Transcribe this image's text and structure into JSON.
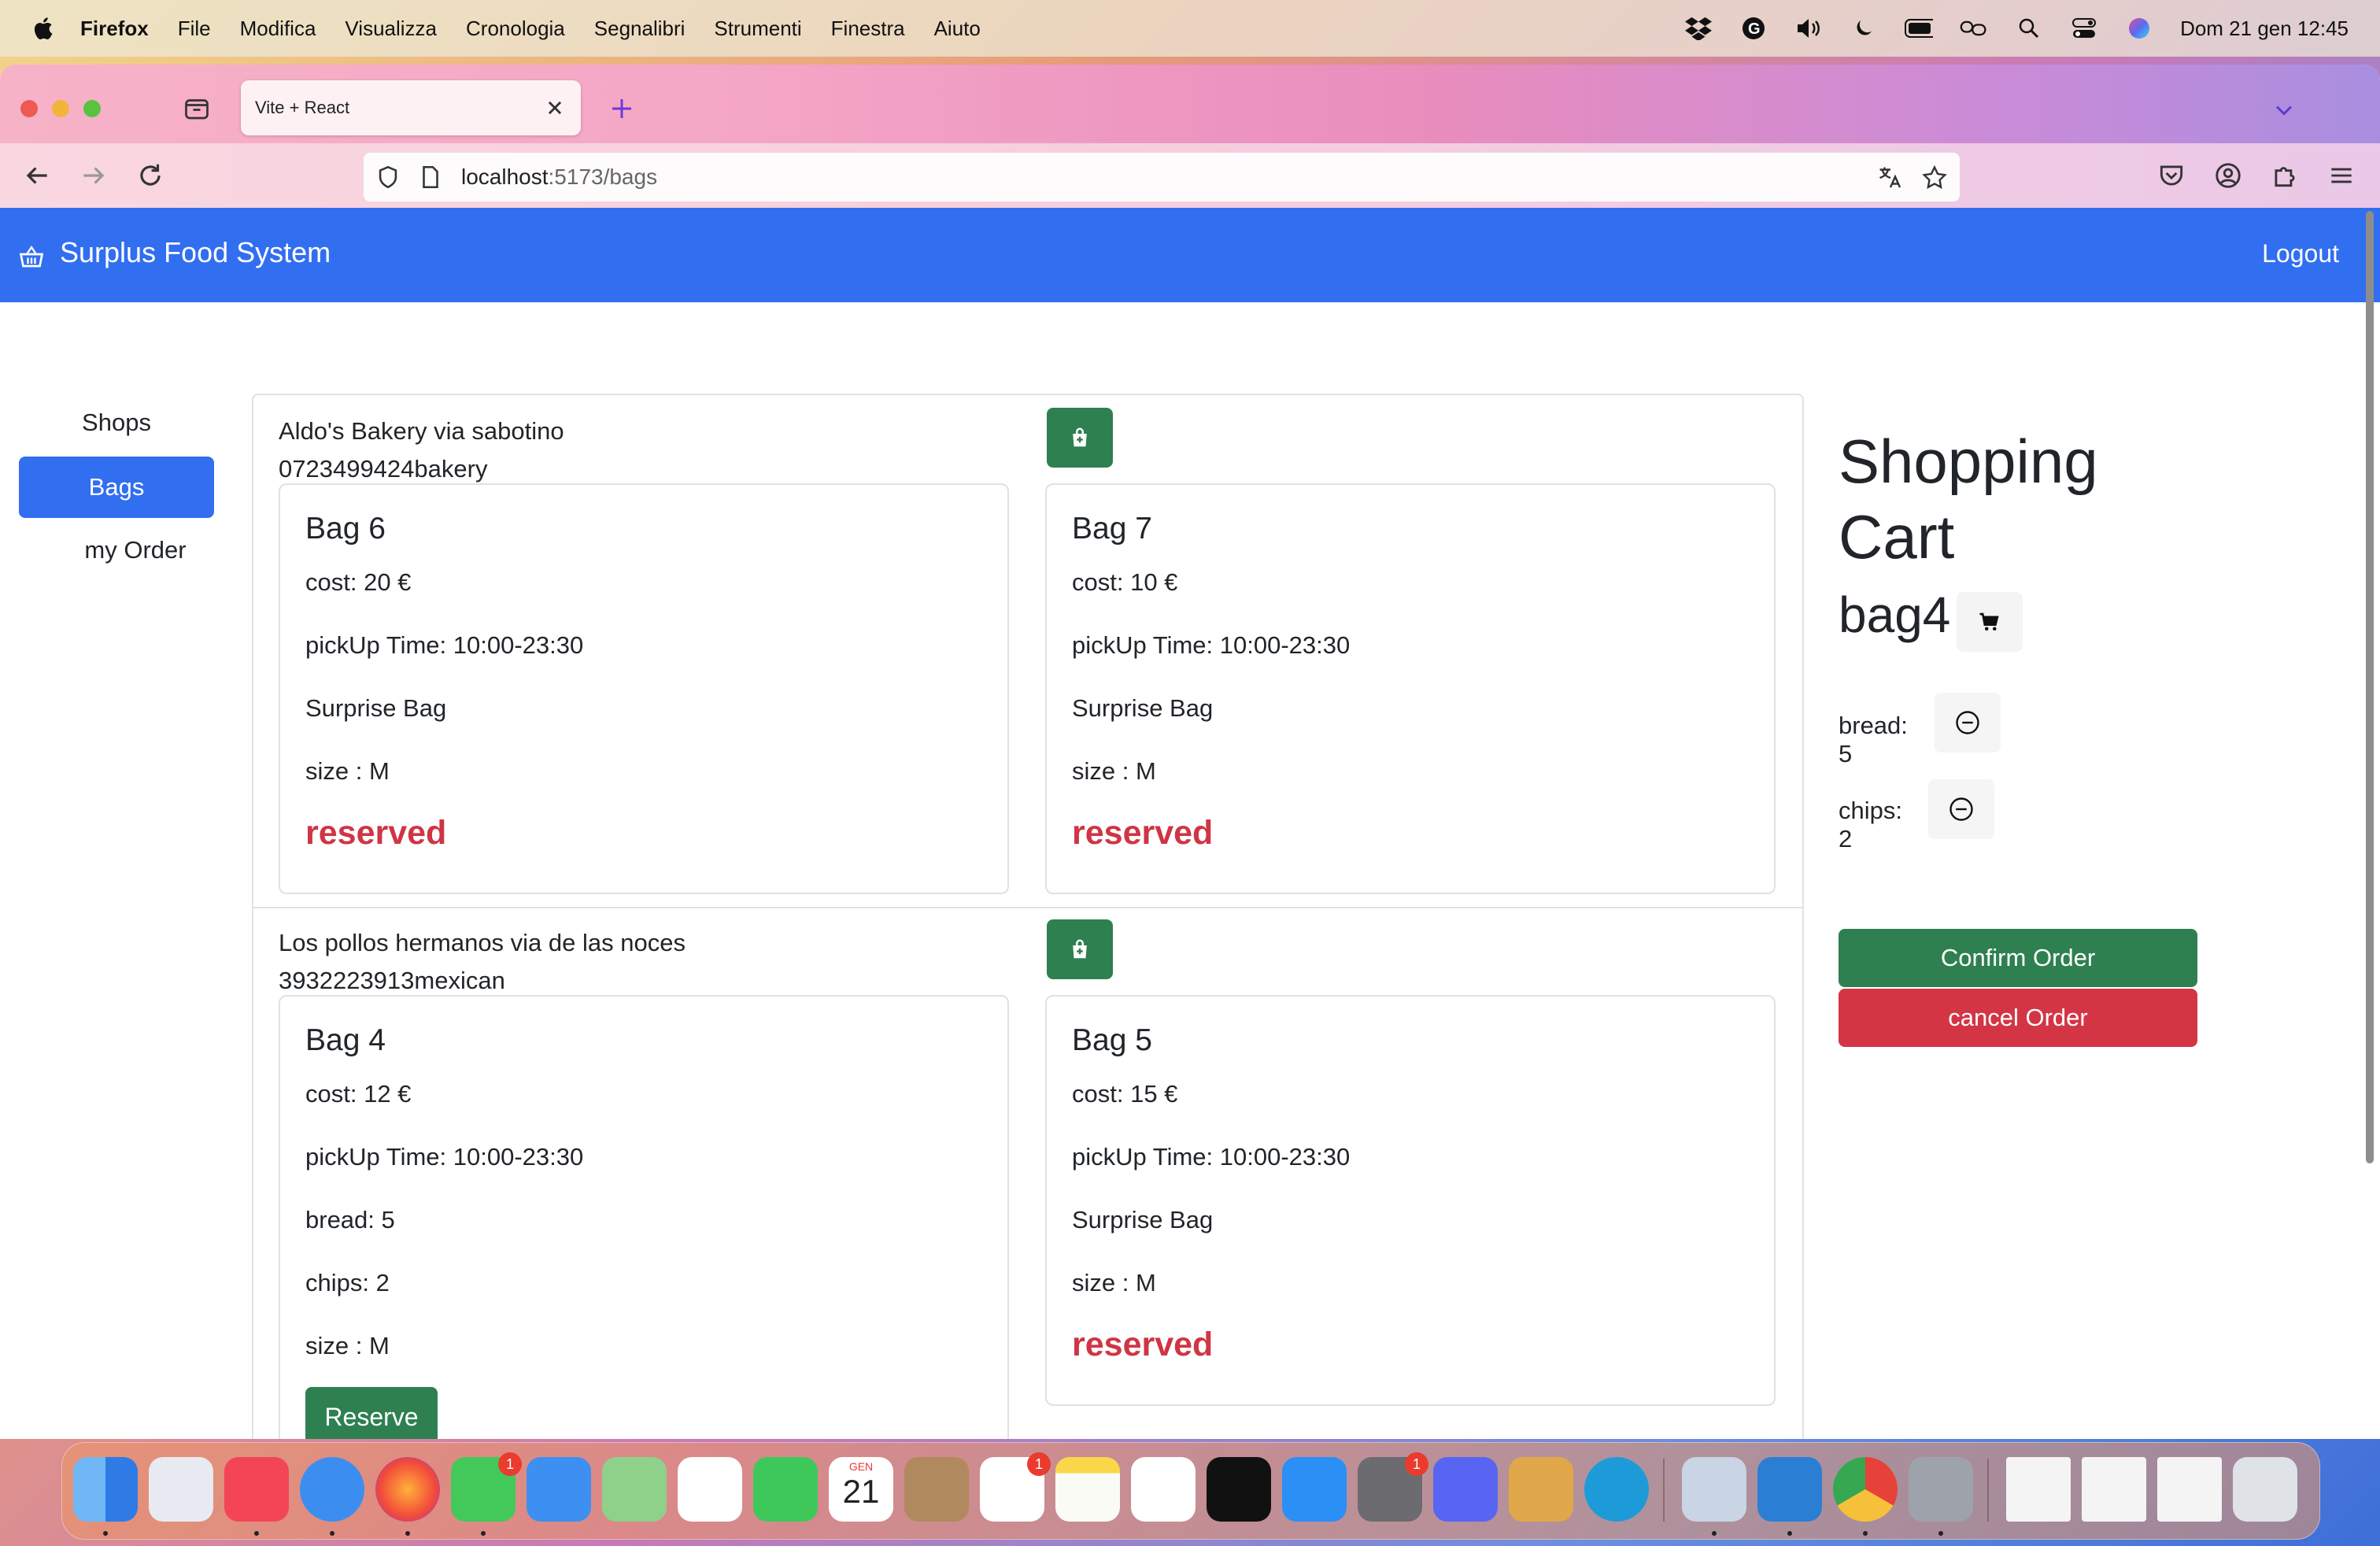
{
  "menubar": {
    "app": "Firefox",
    "items": [
      "File",
      "Modifica",
      "Visualizza",
      "Cronologia",
      "Segnalibri",
      "Strumenti",
      "Finestra",
      "Aiuto"
    ],
    "clock": "Dom 21 gen  12:45"
  },
  "browser": {
    "tab_title": "Vite + React",
    "url_host": "localhost",
    "url_rest": ":5173/bags"
  },
  "app": {
    "brand": "Surplus Food System",
    "logout": "Logout",
    "sidebar": [
      {
        "label": "Shops",
        "active": false
      },
      {
        "label": "Bags",
        "active": true
      },
      {
        "label": "my Order",
        "active": false
      }
    ],
    "shops": [
      {
        "name": "Aldo's Bakery via sabotino",
        "info": "0723499424bakery",
        "bags": [
          {
            "title": "Bag 6",
            "cost": "cost: 20 €",
            "pickup": "pickUp Time: 10:00-23:30",
            "lines": [
              "Surprise Bag",
              "size : M"
            ],
            "status": "reserved"
          },
          {
            "title": "Bag 7",
            "cost": "cost: 10 €",
            "pickup": "pickUp Time: 10:00-23:30",
            "lines": [
              "Surprise Bag",
              "size : M"
            ],
            "status": "reserved"
          }
        ]
      },
      {
        "name": "Los pollos hermanos via de las noces",
        "info": "3932223913mexican",
        "bags": [
          {
            "title": "Bag 4",
            "cost": "cost: 12 €",
            "pickup": "pickUp Time: 10:00-23:30",
            "lines": [
              "bread: 5",
              "chips: 2",
              "size : M"
            ],
            "action": "Reserve"
          },
          {
            "title": "Bag 5",
            "cost": "cost: 15 €",
            "pickup": "pickUp Time: 10:00-23:30",
            "lines": [
              "Surprise Bag",
              "size : M"
            ],
            "status": "reserved"
          }
        ]
      }
    ],
    "cart": {
      "heading": "Shopping Cart",
      "bag": "bag4",
      "items": [
        "bread: 5",
        "chips: 2"
      ],
      "confirm": "Confirm Order",
      "cancel": "cancel Order"
    }
  },
  "dock": {
    "calendar_month": "GEN",
    "calendar_day": "21",
    "badges": {
      "messages": "1",
      "reminders": "1",
      "settings": "1"
    }
  },
  "colors": {
    "primary": "#316ef0",
    "success": "#2e8051",
    "danger": "#cf3545"
  }
}
